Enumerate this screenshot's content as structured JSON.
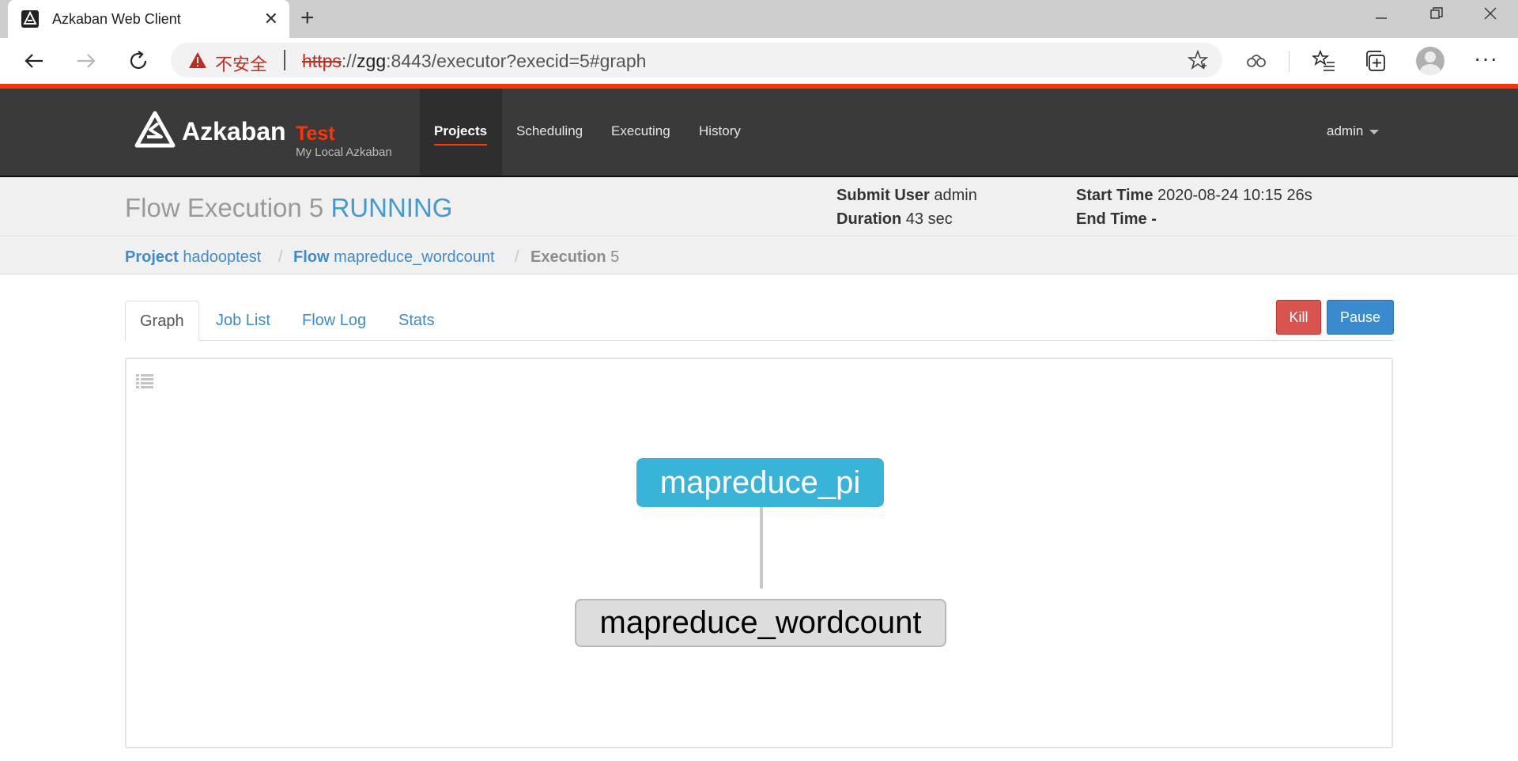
{
  "browser": {
    "tab_title": "Azkaban Web Client",
    "close_tab": "✕",
    "new_tab": "+",
    "security_label": "不安全",
    "url_scheme": "https",
    "url_sep": "://",
    "url_host": "zgg",
    "url_rest": ":8443/executor?execid=5#graph",
    "more": "···",
    "icons": [
      "back-arrow-icon",
      "forward-arrow-icon",
      "refresh-icon",
      "warning-icon",
      "favorite-star-icon",
      "extension-icon",
      "favorites-list-icon",
      "collections-icon",
      "profile-avatar-icon",
      "more-icon"
    ]
  },
  "navbar": {
    "brand": "Azkaban",
    "environment": "Test",
    "subtitle": "My Local Azkaban",
    "items": [
      "Projects",
      "Scheduling",
      "Executing",
      "History"
    ],
    "active_item": "Projects",
    "user": "admin"
  },
  "header": {
    "title_prefix": "Flow Execution 5",
    "status": "RUNNING",
    "submit_user_label": "Submit User",
    "submit_user": "admin",
    "duration_label": "Duration",
    "duration": "43 sec",
    "start_time_label": "Start Time",
    "start_time": "2020-08-24 10:15 26s",
    "end_time_label": "End Time",
    "end_time": "-"
  },
  "breadcrumb": {
    "project_label": "Project",
    "project": "hadooptest",
    "flow_label": "Flow",
    "flow": "mapreduce_wordcount",
    "execution_label": "Execution",
    "execution": "5",
    "separator": "/"
  },
  "tabs": [
    "Graph",
    "Job List",
    "Flow Log",
    "Stats"
  ],
  "active_tab": "Graph",
  "actions": {
    "kill": "Kill",
    "pause": "Pause"
  },
  "graph": {
    "nodes": [
      {
        "name": "mapreduce_pi",
        "status": "running"
      },
      {
        "name": "mapreduce_wordcount",
        "status": "ready"
      }
    ],
    "edges": [
      {
        "from": "mapreduce_pi",
        "to": "mapreduce_wordcount"
      }
    ]
  },
  "colors": {
    "accent": "#ff3601",
    "navbar_bg": "#3a3a3a",
    "running_blue": "#39b3d7",
    "link_blue": "#3f8ccb",
    "kill_red": "#d9534f",
    "pause_blue": "#3a8ad0"
  }
}
